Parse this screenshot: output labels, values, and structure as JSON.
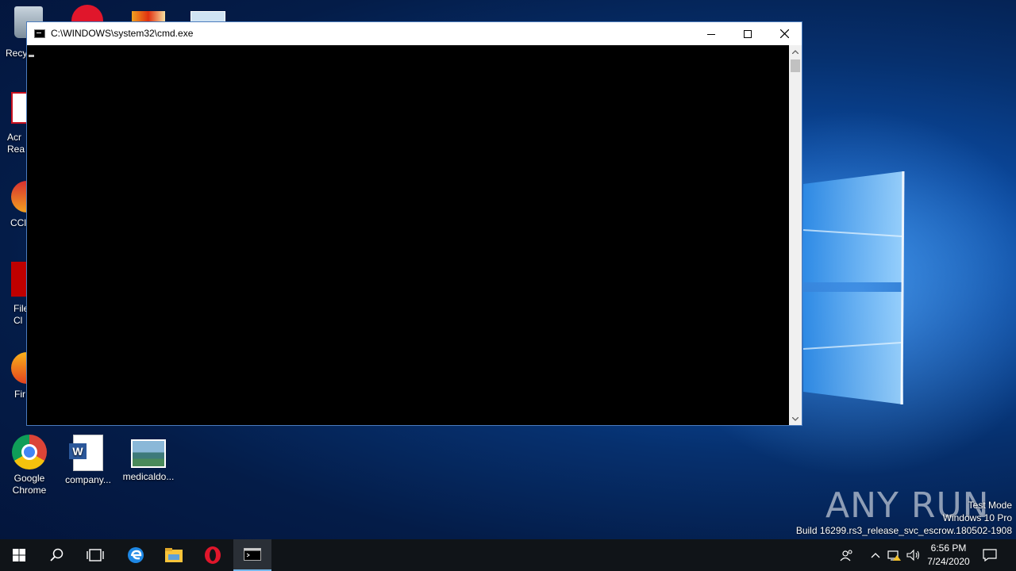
{
  "window": {
    "title": "C:\\WINDOWS\\system32\\cmd.exe",
    "minimize_label": "—",
    "maximize_label": "☐",
    "close_label": "✕"
  },
  "desktop": {
    "icons": [
      {
        "label": "Recy",
        "icon": "recycle-bin-icon"
      },
      {
        "label": "Acr\nRea",
        "icon": "acrobat-reader-icon"
      },
      {
        "label": "CCl",
        "icon": "ccleaner-icon"
      },
      {
        "label": "File\nCl",
        "icon": "filezilla-icon"
      },
      {
        "label": "Fir",
        "icon": "firefox-icon"
      },
      {
        "label": "Google\nChrome",
        "icon": "chrome-icon"
      },
      {
        "label": "company...",
        "icon": "word-document-icon"
      },
      {
        "label": "medicaldo...",
        "icon": "image-file-icon"
      }
    ]
  },
  "taskbar": {
    "start": "windows-start-icon",
    "search": "search-icon",
    "task_view": "task-view-icon",
    "pinned": [
      "edge-icon",
      "file-explorer-icon",
      "opera-icon",
      "cmd-icon"
    ]
  },
  "tray": {
    "time": "6:56 PM",
    "date": "7/24/2020"
  },
  "watermark": {
    "line1": "Test Mode",
    "line2": "Windows 10 Pro",
    "line3": "Build 16299.rs3_release_svc_escrow.180502-1908",
    "brand": "ANY RUN"
  },
  "colors": {
    "accent": "#76b9ed",
    "console_bg": "#000000",
    "desktop_bg": "#0b4aa0"
  }
}
